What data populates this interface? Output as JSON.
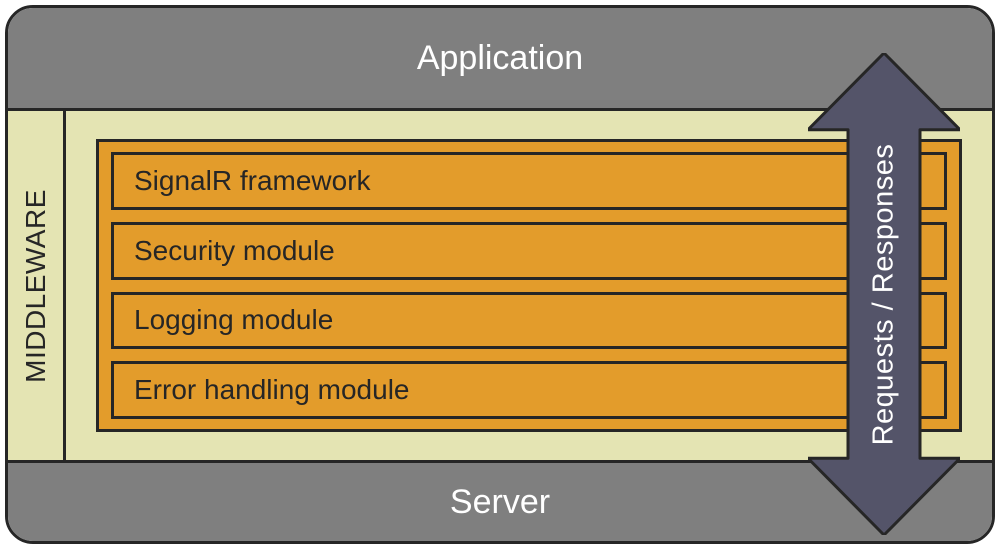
{
  "layers": {
    "top": "Application",
    "bottom": "Server"
  },
  "middleware": {
    "label": "MIDDLEWARE",
    "modules": [
      "SignalR framework",
      "Security module",
      "Logging module",
      "Error handling module"
    ]
  },
  "arrow_label": "Requests / Responses",
  "colors": {
    "bar": "#7f7f7f",
    "bar_text": "#ffffff",
    "cream": "#e4e4b3",
    "orange": "#e39c2b",
    "stroke": "#262626",
    "arrow_fill": "#545469"
  }
}
